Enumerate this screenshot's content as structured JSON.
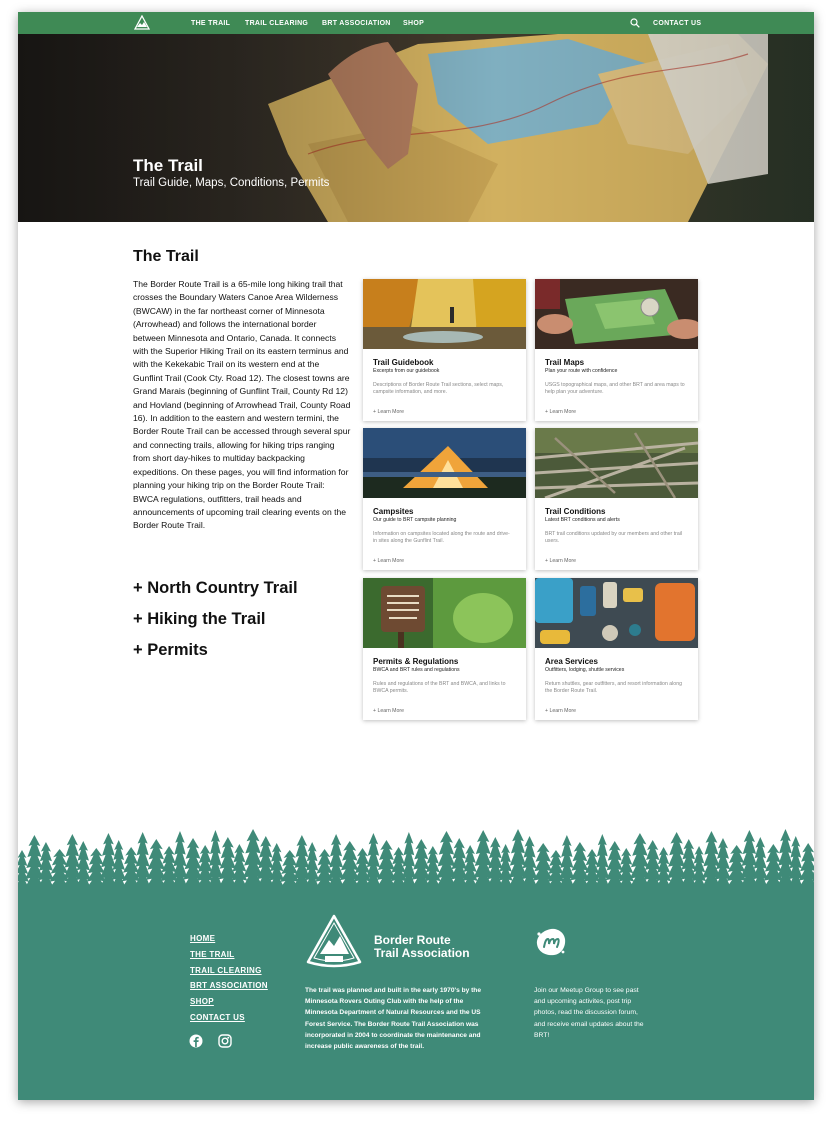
{
  "nav": {
    "items": [
      "THE TRAIL",
      "TRAIL CLEARING",
      "BRT ASSOCIATION",
      "SHOP"
    ],
    "contact": "CONTACT US",
    "icons": [
      "brt-logo-icon",
      "search-icon"
    ]
  },
  "hero": {
    "title": "The Trail",
    "subtitle": "Trail Guide, Maps, Conditions, Permits"
  },
  "intro": {
    "title": "The Trail",
    "body": "The Border Route Trail is a 65-mile long hiking trail that crosses the Boundary Waters Canoe Area Wilderness (BWCAW) in the far northeast corner of Minnesota (Arrowhead) and follows the international border between Minnesota and Ontario, Canada. It connects with the Superior Hiking Trail on its eastern terminus and with the Kekekabic Trail on its western end at the Gunflint Trail (Cook Cty. Road 12). The closest towns are Grand Marais (beginning of Gunflint Trail, County Rd 12) and Hovland (beginning of Arrowhead Trail, County Road 16). In addition to the eastern and western termini, the Border Route Trail can be accessed through several spur and connecting trails, allowing for hiking trips ranging from short day-hikes to multiday backpacking expeditions. On these pages, you will find information for planning your hiking trip on the Border Route Trail: BWCA regulations, outfitters, trail heads and announcements of upcoming trail clearing events on the Border Route Trail."
  },
  "accordions": [
    "+ North Country Trail",
    "+ Hiking the Trail",
    "+ Permits"
  ],
  "cards": [
    {
      "title": "Trail Guidebook",
      "subtitle": "Excerpts from our guidebook",
      "desc": "Descriptions of Border Route Trail sections, select maps, campsite information, and more.",
      "link": "+ Learn More",
      "image": "forest-stream-photo"
    },
    {
      "title": "Trail Maps",
      "subtitle": "Plan your route with confidence",
      "desc": "USGS topographical maps, and other BRT and area maps to help plan your adventure.",
      "link": "+ Learn More",
      "image": "map-compass-photo"
    },
    {
      "title": "Campsites",
      "subtitle": "Our guide to BRT campsite planning",
      "desc": "Information on campsites located along the route and drive-in sites along the Gunflint Trail.",
      "link": "+ Learn More",
      "image": "tent-night-photo"
    },
    {
      "title": "Trail Conditions",
      "subtitle": "Latest BRT conditions and alerts",
      "desc": "BRT trail conditions updated by our members and other trail users.",
      "link": "+ Learn More",
      "image": "fallen-trees-photo"
    },
    {
      "title": "Permits & Regulations",
      "subtitle": "BWCA and BRT rules and regulations",
      "desc": "Rules and regulations of the BRT and BWCA, and links to BWCA permits.",
      "link": "+ Learn More",
      "image": "wilderness-sign-photo"
    },
    {
      "title": "Area Services",
      "subtitle": "Outfitters, lodging, shuttle services",
      "desc": "Return shuttles, gear outfitters, and resort information along the Border Route Trail.",
      "link": "+ Learn More",
      "image": "gear-flatlay-photo"
    }
  ],
  "footer": {
    "links": [
      "HOME",
      "THE TRAIL",
      "TRAIL CLEARING",
      "BRT ASSOCIATION",
      "SHOP",
      "CONTACT US"
    ],
    "org_line1": "Border Route",
    "org_line2": "Trail Association",
    "about": "The trail was planned and built in the early 1970's by the Minnesota Rovers Outing Club with the help of the Minnesota Department of Natural Resources and the US Forest Service. The Border Route Trail Association was incorporated in 2004 to coordinate the maintenance and increase public awareness of the trail.",
    "meetup": "Join our Meetup Group to see past and upcoming activites, post trip photos, read the discussion forum, and receive email updates about the BRT!",
    "social_icons": [
      "facebook-icon",
      "instagram-icon"
    ],
    "colors": {
      "nav": "#3f8a55",
      "footer": "#3f8a78",
      "trees": "#3f8a78"
    }
  }
}
